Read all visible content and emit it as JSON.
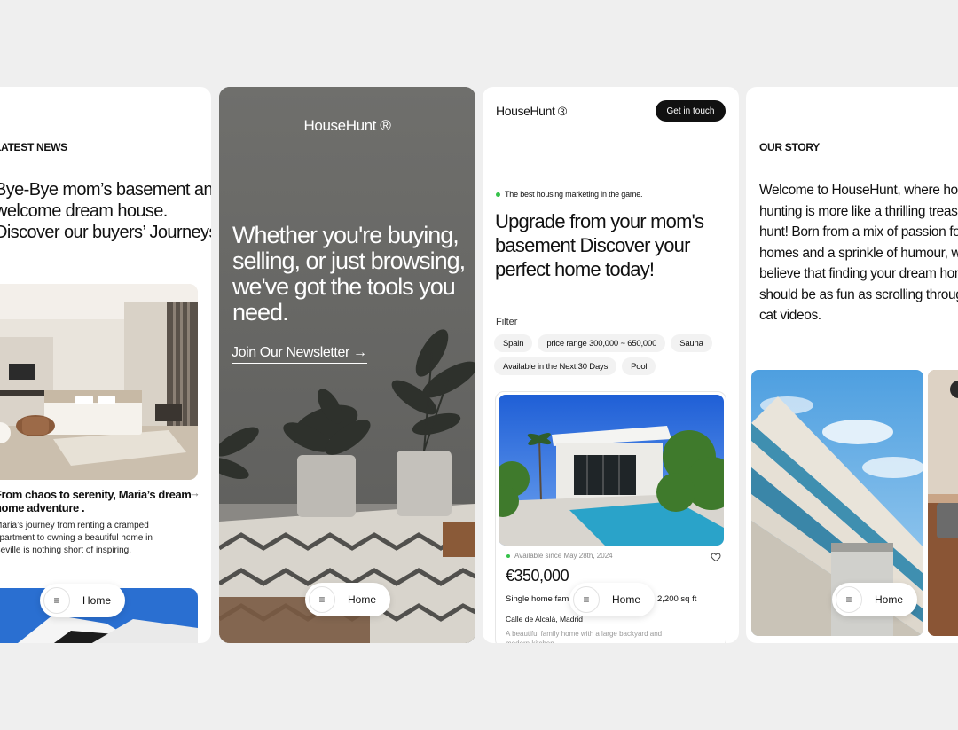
{
  "news_screen": {
    "section_label": "LATEST NEWS",
    "headline": "Bye-Bye mom’s basement and welcome dream house. Discover our buyers’ Journeys!",
    "card_title": "From chaos to serenity, Maria’s dream home adventure .",
    "card_desc": "Maria’s journey from renting a cramped apartment to owning a beautiful home in Seville is nothing short of inspiring.",
    "nav_label": "Home"
  },
  "newsletter_screen": {
    "brand": "HouseHunt ®",
    "headline": "Whether you're buying, selling, or just browsing, we've got the tools you need.",
    "newsletter_link": "Join Our Newsletter →",
    "nav_label": "Home"
  },
  "listing_screen": {
    "brand": "HouseHunt ®",
    "cta": "Get in touch",
    "tagline": "The best housing marketing in the game.",
    "headline": "Upgrade from your mom's basement Discover your perfect home today!",
    "filter_label": "Filter",
    "filters": [
      "Spain",
      "price range 300,000 ~ 650,000",
      "Sauna",
      "Available in the Next 30 Days",
      "Pool"
    ],
    "listing": {
      "availability": "Available since May 28th, 2024",
      "price": "€350,000",
      "type": "Single home fam",
      "sqft": "2,200 sq ft",
      "address": "Calle de Alcalá, Madrid",
      "description": "A beautiful family home with a large backyard and modern kitchen."
    },
    "nav_label": "Home"
  },
  "story_screen": {
    "section_label": "OUR STORY",
    "story": "Welcome to HouseHunt, where house hunting is more like a thrilling treasure hunt!  Born from a mix of passion for homes and a sprinkle of humour, we believe that finding your dream home should be as fun as scrolling through cat videos.",
    "nav_label": "Home"
  },
  "icons": {
    "menu": "menu-icon",
    "arrow": "arrow-right-icon",
    "heart": "heart-icon"
  },
  "colors": {
    "accent_dot": "#35c24a",
    "cta_bg": "#111111",
    "newsletter_bg": "#6b6b69"
  }
}
